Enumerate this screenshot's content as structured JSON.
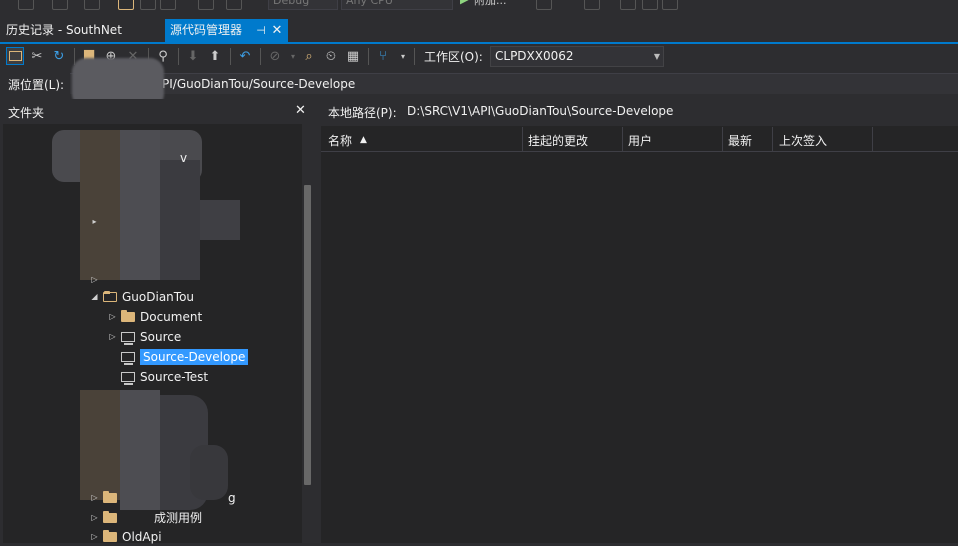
{
  "top_toolbar": {
    "config": "Debug",
    "platform": "Any CPU",
    "run_label": "附加..."
  },
  "tabs": [
    {
      "label": "历史记录 - SouthNet",
      "active": false
    },
    {
      "label": "源代码管理器",
      "active": true
    }
  ],
  "toolbar": {
    "workspace_label": "工作区(O):",
    "workspace_value": "CLPDXX0062"
  },
  "source_location": {
    "label": "源位置(L):",
    "path": "PI/GuoDianTou/Source-Develope"
  },
  "folder_pane": {
    "title": "文件夹",
    "items": [
      {
        "label": "v",
        "depth": 3
      },
      {
        "label": "GuoDianTou",
        "depth": 1,
        "expanded": true
      },
      {
        "label": "Document",
        "depth": 2,
        "type": "folder"
      },
      {
        "label": "Source",
        "depth": 2,
        "type": "source"
      },
      {
        "label": "Source-Develope",
        "depth": 2,
        "type": "source",
        "selected": true
      },
      {
        "label": "Source-Test",
        "depth": 2,
        "type": "source"
      },
      {
        "label": "g",
        "depth": 3
      },
      {
        "label": "成测用例",
        "depth": 1,
        "type": "folder"
      },
      {
        "label": "OldApi",
        "depth": 1,
        "type": "folder"
      }
    ]
  },
  "details": {
    "local_path_label": "本地路径(P):",
    "local_path": "D:\\SRC\\V1\\API\\GuoDianTou\\Source-Develope",
    "columns": [
      "名称",
      "挂起的更改",
      "用户",
      "最新",
      "上次签入"
    ],
    "sort_indicator": "▲"
  },
  "colors": {
    "accent": "#007acc",
    "selection": "#3399ff",
    "background": "#2d2d30",
    "pane": "#252526"
  }
}
